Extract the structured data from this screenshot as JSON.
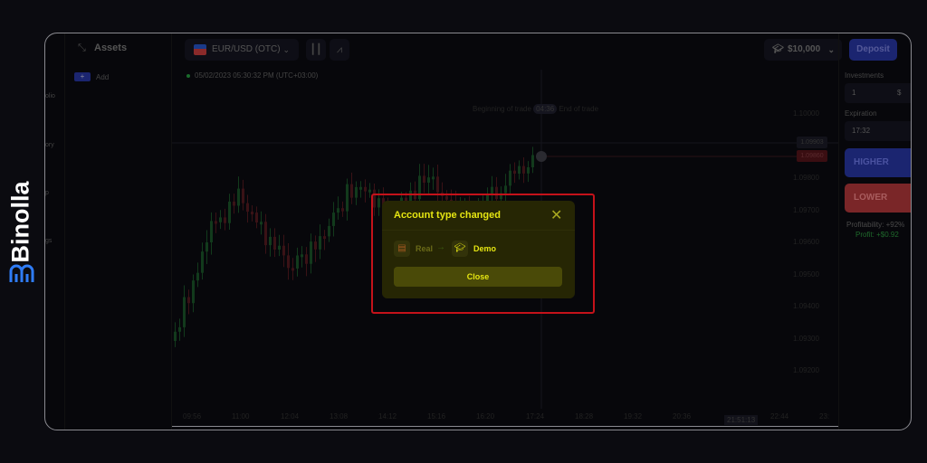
{
  "brand": {
    "name": "Binolla",
    "color": "#2f7cf6"
  },
  "nav": {
    "items": [
      "olio",
      "ory",
      "p",
      "gs"
    ]
  },
  "assets": {
    "title": "Assets",
    "add_label": "Add",
    "add_icon": "+"
  },
  "toolbar": {
    "pair": "EUR/USD (OTC)",
    "balance": "$10,000",
    "deposit": "Deposit"
  },
  "chart": {
    "datetime": "05/02/2023  05:30:32 PM  (UTC+03:00)",
    "trade_begin": "Beginning of trade",
    "trade_timer": "04:36",
    "trade_end": "End of trade",
    "y_ticks": [
      "1.10000",
      "1.09800",
      "1.09700",
      "1.09600",
      "1.09500",
      "1.09400",
      "1.09300",
      "1.09200"
    ],
    "price_tags": {
      "upper": "1.09903",
      "current": "1.09860"
    },
    "x_ticks": [
      "09:56",
      "11:00",
      "12:04",
      "13:08",
      "14:12",
      "15:16",
      "16:20",
      "17:24",
      "18:28",
      "19:32",
      "20:36",
      "22:44",
      "23:"
    ],
    "current_time": "21:51:13"
  },
  "trade": {
    "investments_label": "Investments",
    "investment_value": "1",
    "currency": "$",
    "expiration_label": "Expiration",
    "expiration_value": "17:32",
    "higher": "HIGHER",
    "lower": "LOWER",
    "profitability": "Profitability: +92%",
    "profit": "Profit: +$0.92"
  },
  "modal": {
    "title": "Account type changed",
    "from": "Real",
    "to": "Demo",
    "close_button": "Close",
    "accent": "#e6e612"
  }
}
